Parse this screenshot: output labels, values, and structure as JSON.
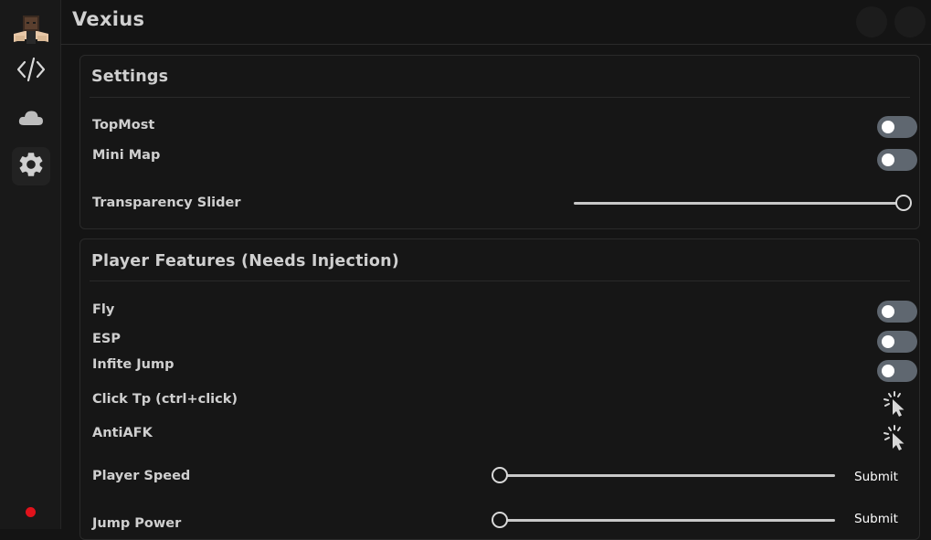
{
  "app": {
    "title": "Vexius"
  },
  "sidebar": {
    "items": [
      {
        "icon": "code-icon"
      },
      {
        "icon": "cloud-icon"
      },
      {
        "icon": "gear-icon"
      }
    ],
    "status_color": "#e0121b"
  },
  "settings": {
    "title": "Settings",
    "topmost_label": "TopMost",
    "topmost_on": false,
    "minimap_label": "Mini Map",
    "minimap_on": false,
    "transparency_label": "Transparency Slider",
    "transparency_value": 1.0
  },
  "player": {
    "title": "Player Features (Needs  Injection)",
    "fly_label": "Fly",
    "fly_on": false,
    "esp_label": "ESP",
    "esp_on": false,
    "infjump_label": "Infite Jump",
    "infjump_on": false,
    "clicktp_label": "Click Tp (ctrl+click)",
    "antiafk_label": "AntiAFK",
    "speed_label": "Player Speed",
    "speed_value": 0.0,
    "speed_submit": "Submit",
    "jump_label": "Jump Power",
    "jump_value": 0.0,
    "jump_submit": "Submit"
  },
  "colors": {
    "toggle_off": "#5f6770",
    "accent_status": "#e0121b"
  }
}
